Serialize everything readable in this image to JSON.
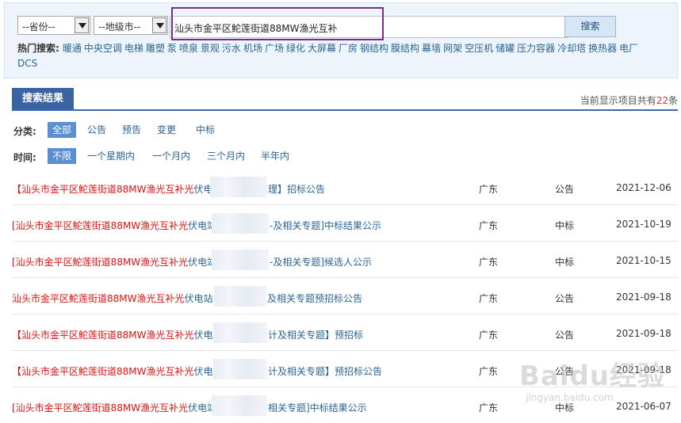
{
  "search": {
    "province_placeholder": "--省份--",
    "city_placeholder": "--地级市--",
    "keyword": "汕头市金平区鮀莲街道88MW渔光互补",
    "button_label": "搜索"
  },
  "hot_search": {
    "label": "热门搜索:",
    "terms": [
      "暖通",
      "中央空调",
      "电梯",
      "雕塑",
      "泵",
      "喷泉",
      "景观",
      "污水",
      "机场",
      "广场",
      "绿化",
      "大屏幕",
      "厂房",
      "钢结构",
      "膜结构",
      "幕墙",
      "网架",
      "空压机",
      "储罐",
      "压力容器",
      "冷却塔",
      "换热器",
      "电厂",
      "DCS"
    ]
  },
  "results_header": {
    "tab_label": "搜索结果",
    "count_prefix": "当前显示项目共有",
    "count": "22",
    "count_suffix": "条"
  },
  "filters": {
    "category": {
      "label": "分类:",
      "options": [
        "全部",
        "公告",
        "预告",
        "变更",
        "中标"
      ],
      "active": "全部"
    },
    "time": {
      "label": "时间:",
      "options": [
        "不限",
        "一个星期内",
        "一个月内",
        "三个月内",
        "半年内"
      ],
      "active": "不限"
    }
  },
  "results": [
    {
      "prefix": "【",
      "keyword": "汕头市金平区鮀莲街道88MW渔光互补光",
      "rest_before": "伏电",
      "rest_after": "理】招标公告",
      "region": "广东",
      "type": "公告",
      "date": "2021-12-06"
    },
    {
      "prefix": "[",
      "keyword": "汕头市金平区鮀莲街道88MW渔光互补光",
      "rest_before": "伏电站",
      "rest_after": "-及相关专题]中标结果公示",
      "region": "广东",
      "type": "中标",
      "date": "2021-10-19"
    },
    {
      "prefix": "[",
      "keyword": "汕头市金平区鮀莲街道88MW渔光互补光",
      "rest_before": "伏电站",
      "rest_after": "-及相关专题]候选人公示",
      "region": "广东",
      "type": "中标",
      "date": "2021-10-15"
    },
    {
      "prefix": "",
      "keyword": "汕头市金平区鮀莲街道88MW渔光互补光",
      "rest_before": "伏电站",
      "rest_after": "及相关专题预招标公告",
      "region": "广东",
      "type": "公告",
      "date": "2021-09-18"
    },
    {
      "prefix": "【",
      "keyword": "汕头市金平区鮀莲街道88MW渔光互补光",
      "rest_before": "伏电",
      "rest_after": "计及相关专题】预招标",
      "region": "广东",
      "type": "公告",
      "date": "2021-09-18"
    },
    {
      "prefix": "【",
      "keyword": "汕头市金平区鮀莲街道88MW渔光互补光",
      "rest_before": "伏电",
      "rest_after": "计及相关专题】预招标公告",
      "region": "广东",
      "type": "公告",
      "date": "2021-09-18"
    },
    {
      "prefix": "[",
      "keyword": "汕头市金平区鮀莲街道88MW渔光互补光",
      "rest_before": "伏电站",
      "rest_after": "相关专题]中标结果公示",
      "region": "广东",
      "type": "中标",
      "date": "2021-06-07"
    }
  ],
  "watermark": {
    "main": "Baidu经验",
    "sub": "jingyan.baidu.com"
  }
}
